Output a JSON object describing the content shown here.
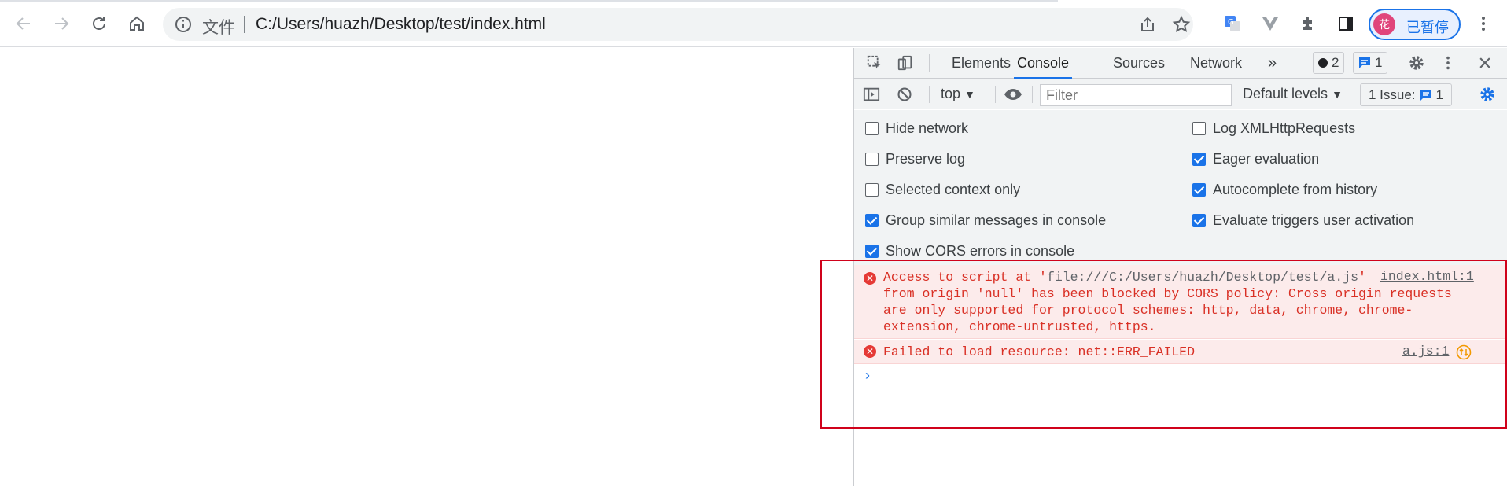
{
  "browser": {
    "scheme_label": "文件",
    "url": "C:/Users/huazh/Desktop/test/index.html",
    "profile_initial": "花",
    "profile_label": "已暂停"
  },
  "devtools": {
    "tabs": [
      "Elements",
      "Console",
      "Sources",
      "Network"
    ],
    "active_tab": "Console",
    "more_tabs": "»",
    "errors_count": "2",
    "messages_count": "1",
    "context": "top",
    "filter_placeholder": "Filter",
    "levels": "Default levels",
    "issues_label": "1 Issue:",
    "issues_count": "1",
    "settings_left": [
      {
        "label": "Hide network",
        "checked": false
      },
      {
        "label": "Preserve log",
        "checked": false
      },
      {
        "label": "Selected context only",
        "checked": false
      },
      {
        "label": "Group similar messages in console",
        "checked": true
      },
      {
        "label": "Show CORS errors in console",
        "checked": true
      }
    ],
    "settings_right": [
      {
        "label": "Log XMLHttpRequests",
        "checked": false
      },
      {
        "label": "Eager evaluation",
        "checked": true
      },
      {
        "label": "Autocomplete from history",
        "checked": true
      },
      {
        "label": "Evaluate triggers user activation",
        "checked": true
      }
    ],
    "messages": [
      {
        "line1_prefix": "Access to script at '",
        "line1_link": "file:///C:/Users/huazh/Desktop/test/a.js",
        "line1_suffix": "'",
        "rest": "from origin 'null' has been blocked by CORS policy: Cross origin requests\nare only supported for protocol schemes: http, data, chrome, chrome-\nextension, chrome-untrusted, https.",
        "source": "index.html:1"
      },
      {
        "text": "Failed to load resource: net::ERR_FAILED",
        "source": "a.js:1"
      }
    ],
    "prompt": "›"
  },
  "colors": {
    "error": "#d93025",
    "accent": "#1a73e8",
    "highlight_box": "#d0021b"
  }
}
